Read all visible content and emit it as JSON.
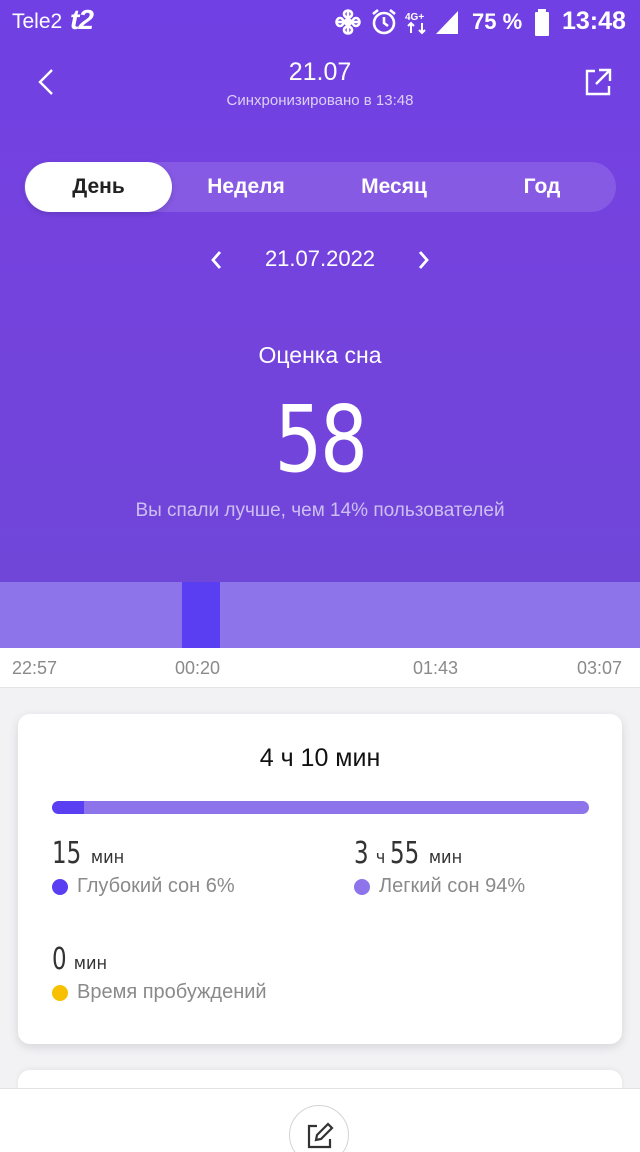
{
  "status_bar": {
    "carrier": "Tele2",
    "carrier_logo": "t2",
    "battery_percent": "75 %",
    "time": "13:48",
    "network": "4G+",
    "icons": [
      "fan-icon",
      "alarm-icon",
      "network-4g-icon",
      "signal-icon",
      "battery-icon"
    ]
  },
  "header": {
    "title": "21.07",
    "subtitle": "Синхронизировано в 13:48"
  },
  "tabs": [
    {
      "label": "День",
      "active": true
    },
    {
      "label": "Неделя",
      "active": false
    },
    {
      "label": "Месяц",
      "active": false
    },
    {
      "label": "Год",
      "active": false
    }
  ],
  "date_nav": {
    "date": "21.07.2022"
  },
  "score": {
    "label": "Оценка сна",
    "value": "58",
    "comparison": "Вы спали лучше, чем 14% пользователей"
  },
  "timeline": {
    "ticks": [
      "22:57",
      "00:20",
      "01:43",
      "03:07"
    ],
    "deep_sleep_segment": {
      "start": "00:08",
      "end": "00:23"
    },
    "colors": {
      "light": "#8e74ea",
      "deep": "#5a3ef2"
    }
  },
  "summary": {
    "total": "4 ч 10 мин",
    "deep_fraction": 0.06,
    "deep": {
      "num1": "15",
      "unit1": "мин",
      "label": "Глубокий сон 6%",
      "color": "#5a3ef2"
    },
    "light": {
      "num1": "3",
      "unit1": "ч",
      "num2": "55",
      "unit2": "мин",
      "label": "Легкий сон 94%",
      "color": "#8e74ea"
    },
    "awake": {
      "num1": "0",
      "unit1": "мин",
      "label": "Время пробуждений",
      "color": "#f7c000"
    }
  },
  "colors": {
    "accent": "#7542de",
    "deep": "#5a3ef2",
    "light": "#8e74ea",
    "awake": "#f7c000"
  }
}
